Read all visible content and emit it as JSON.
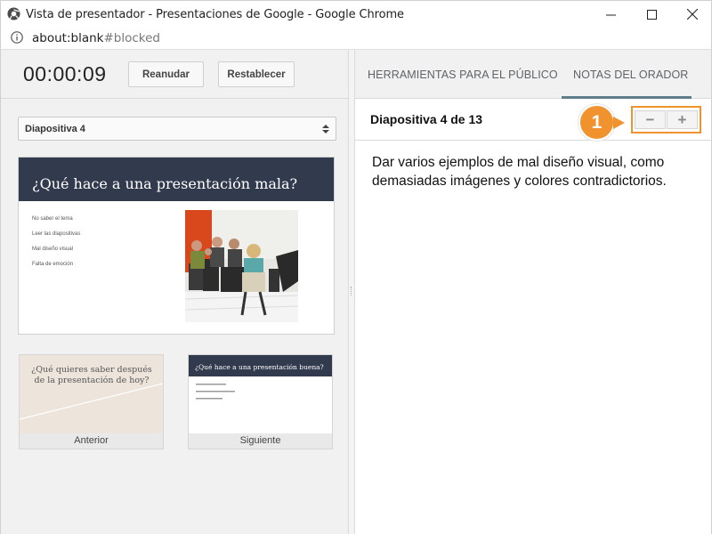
{
  "window": {
    "title": "Vista de presentador - Presentaciones de Google - Google Chrome",
    "address": {
      "host": "about:blank",
      "fragment": "#blocked"
    }
  },
  "presenter": {
    "timer": "00:00:09",
    "resume_label": "Reanudar",
    "reset_label": "Restablecer",
    "slide_select_value": "Diapositiva 4"
  },
  "current_slide": {
    "title": "¿Qué hace a una presentación mala?",
    "bullets": [
      "No saber el tema",
      "Leer las diapositivas",
      "Mal diseño visual",
      "Falta de emoción"
    ]
  },
  "previous_slide": {
    "title": "¿Qué quieres saber después de la presentación de hoy?",
    "caption": "Anterior"
  },
  "next_slide": {
    "title": "¿Qué hace a una presentación buena?",
    "caption": "Siguiente"
  },
  "right_panel": {
    "tabs": [
      {
        "label": "HERRAMIENTAS PARA EL PÚBLICO",
        "active": false
      },
      {
        "label": "NOTAS DEL ORADOR",
        "active": true
      }
    ],
    "slide_count": "Diapositiva 4 de 13",
    "zoom_out_label": "−",
    "zoom_in_label": "+",
    "callout_number": "1",
    "notes": "Dar varios ejemplos de mal diseño visual, como demasiadas imágenes y colores contradictorios."
  },
  "colors": {
    "slide_header": "#323a4e",
    "callout": "#f0922e",
    "tab_underline": "#5f7c8a"
  }
}
